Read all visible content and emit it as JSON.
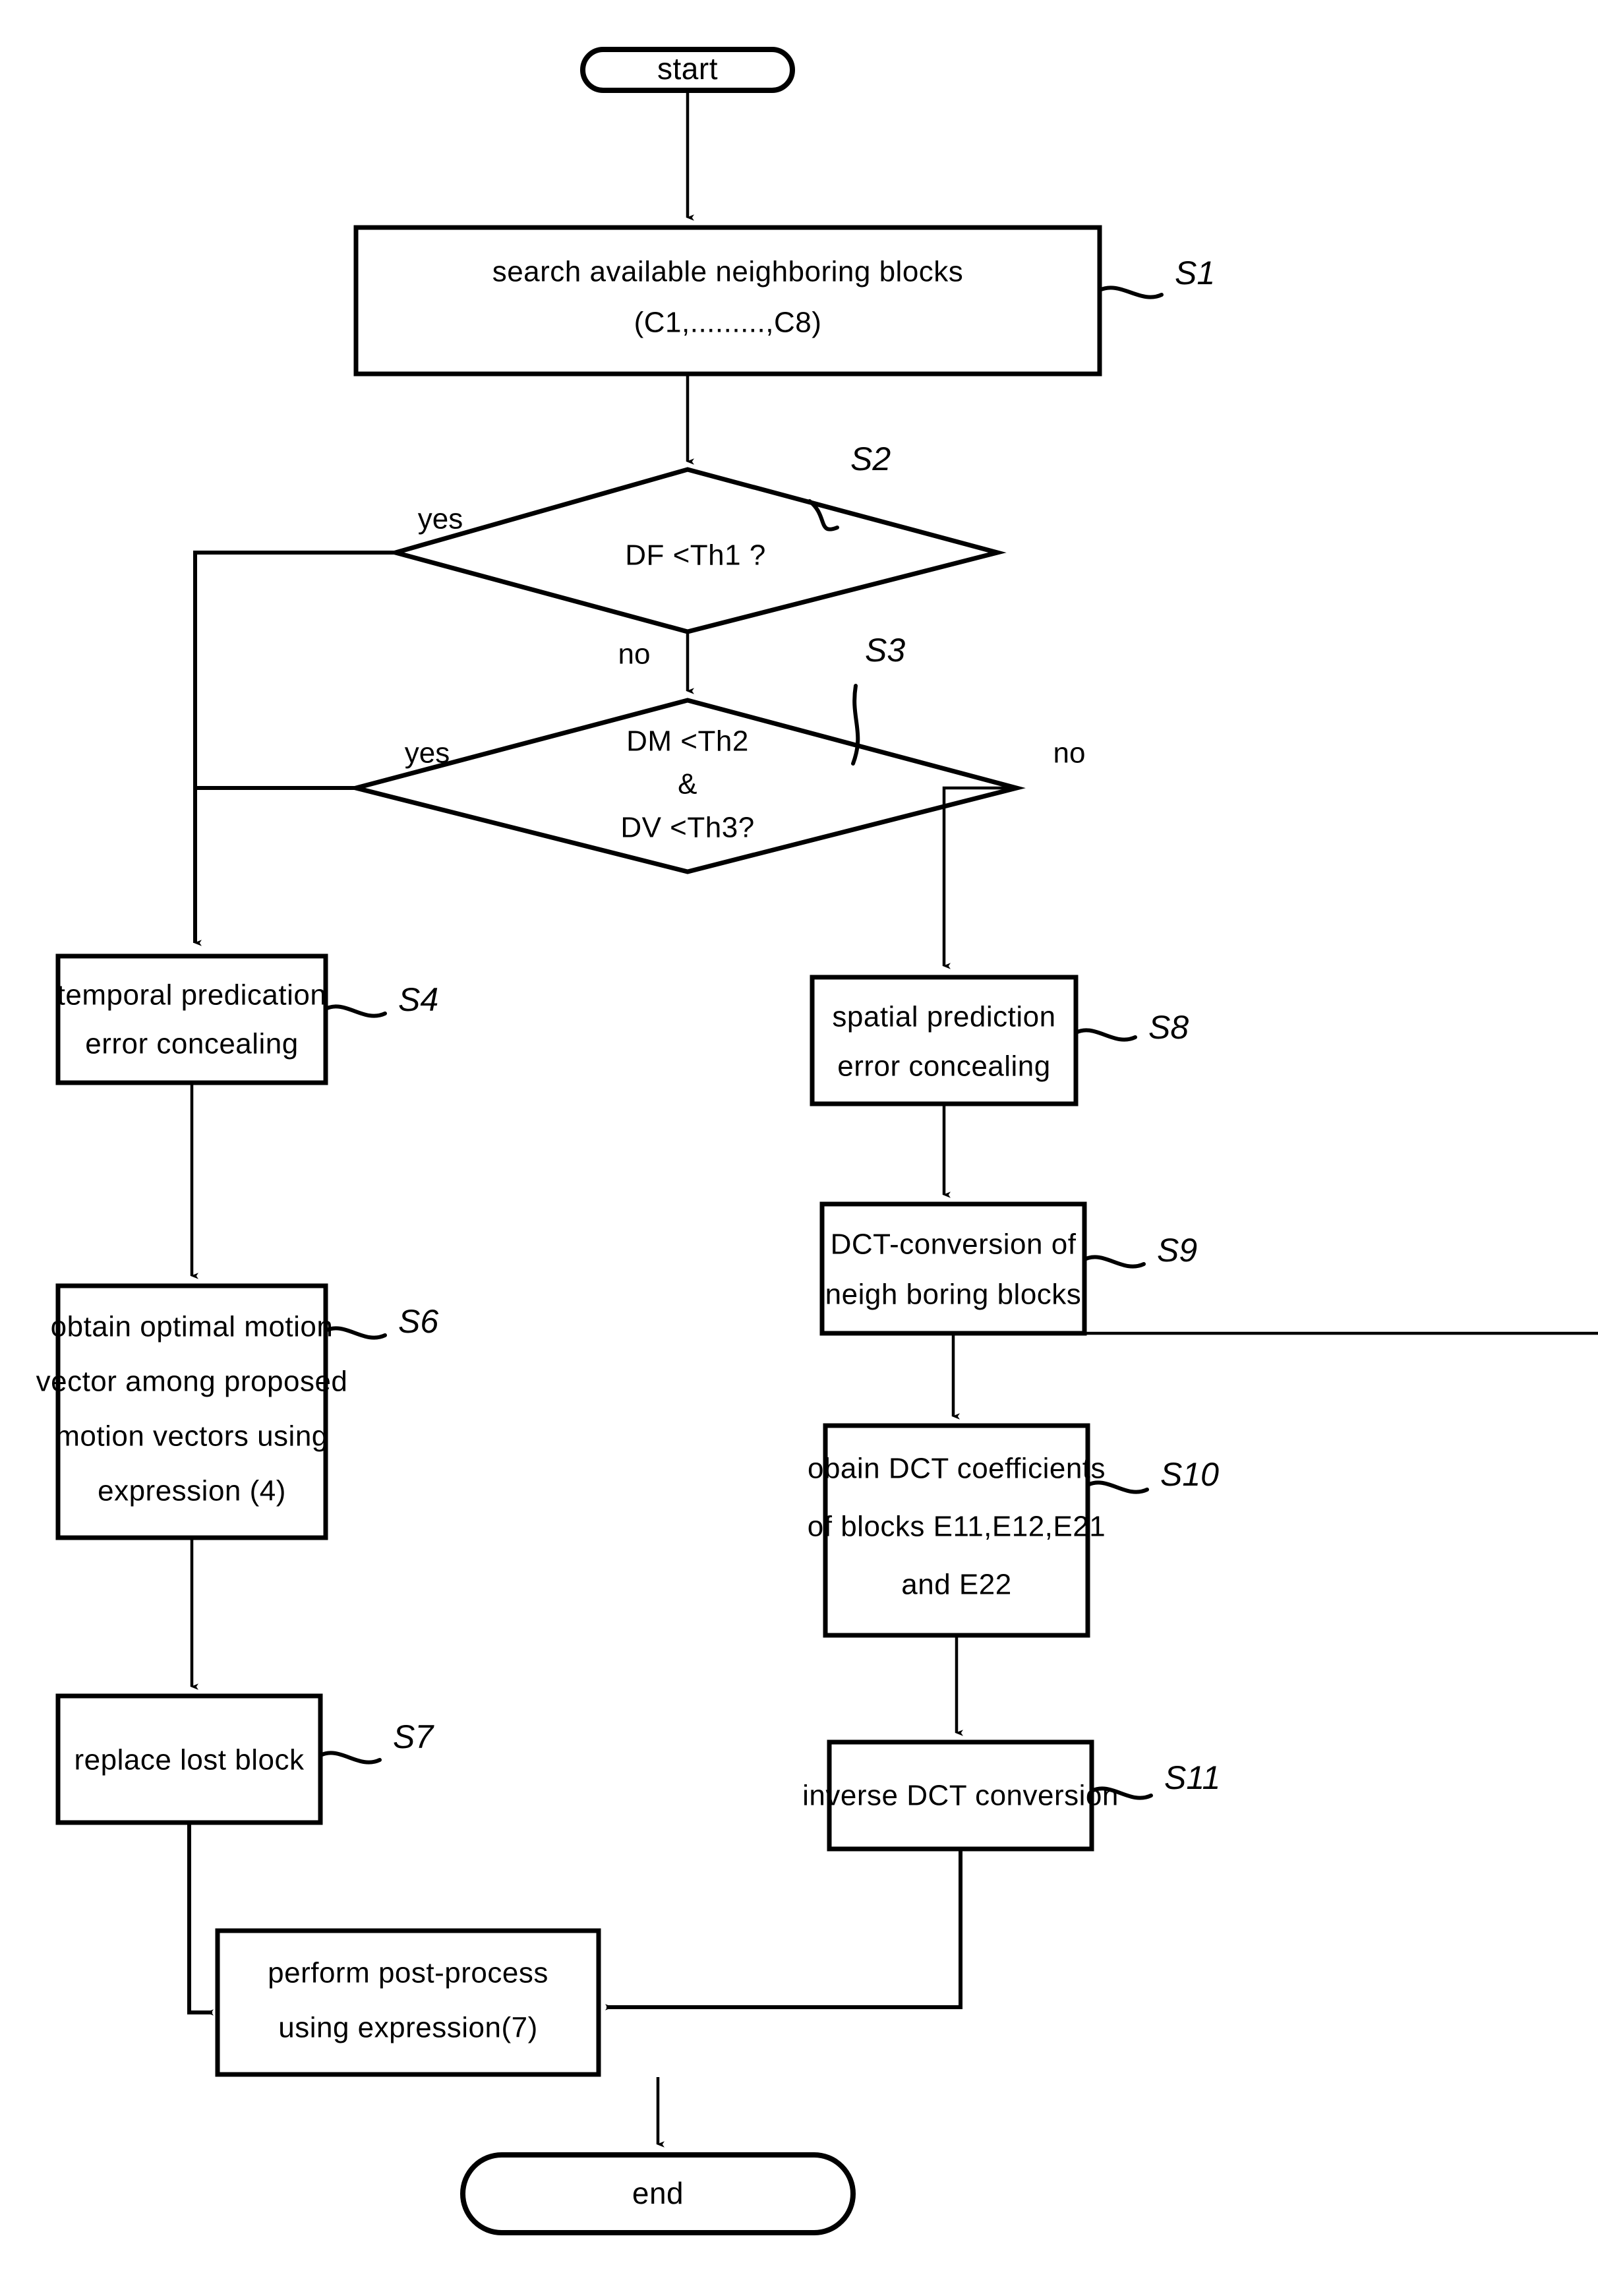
{
  "figure": {
    "type": "flowchart",
    "orientation": "top-to-bottom",
    "background_color": "#ffffff",
    "line_color": "#000000"
  },
  "nodes": {
    "start": {
      "id": "start",
      "shape": "terminator",
      "label": "start"
    },
    "s1": {
      "id": "S1",
      "shape": "process",
      "step": "S1",
      "lines": [
        "search available neighboring blocks",
        "(C1,.........,C8)"
      ]
    },
    "s2": {
      "id": "S2",
      "shape": "decision",
      "step": "S2",
      "lines": [
        "DF <Th1 ?"
      ]
    },
    "s3": {
      "id": "S3",
      "shape": "decision",
      "step": "S3",
      "lines": [
        "DM <Th2",
        "&",
        "DV <Th3?"
      ]
    },
    "s4": {
      "id": "S4",
      "shape": "process",
      "step": "S4",
      "lines": [
        "temporal predication",
        "error concealing"
      ]
    },
    "s6": {
      "id": "S6",
      "shape": "process",
      "step": "S6",
      "lines": [
        "obtain optimal motion",
        "vector among proposed",
        "motion vectors using",
        "expression (4)"
      ]
    },
    "s7": {
      "id": "S7",
      "shape": "process",
      "step": "S7",
      "lines": [
        "replace lost block"
      ]
    },
    "s8": {
      "id": "S8",
      "shape": "process",
      "step": "S8",
      "lines": [
        "spatial prediction",
        "error concealing"
      ]
    },
    "s9": {
      "id": "S9",
      "shape": "process",
      "step": "S9",
      "lines": [
        "DCT-conversion of",
        "neigh boring blocks"
      ]
    },
    "s10": {
      "id": "S10",
      "shape": "process",
      "step": "S10",
      "lines": [
        "obain DCT coefficients",
        "of blocks E11,E12,E21",
        "and E22"
      ]
    },
    "s11": {
      "id": "S11",
      "shape": "process",
      "step": "S11",
      "lines": [
        "inverse DCT conversion"
      ]
    },
    "post": {
      "id": "post",
      "shape": "process",
      "step": "",
      "lines": [
        "perform post-process",
        "using expression(7)"
      ]
    },
    "end": {
      "id": "end",
      "shape": "terminator",
      "label": "end"
    }
  },
  "edge_labels": {
    "s2_yes": "yes",
    "s2_no": "no",
    "s3_yes": "yes",
    "s3_no": "no"
  },
  "step_labels": {
    "s1": "S1",
    "s2": "S2",
    "s3": "S3",
    "s4": "S4",
    "s6": "S6",
    "s7": "S7",
    "s8": "S8",
    "s9": "S9",
    "s10": "S10",
    "s11": "S11"
  }
}
